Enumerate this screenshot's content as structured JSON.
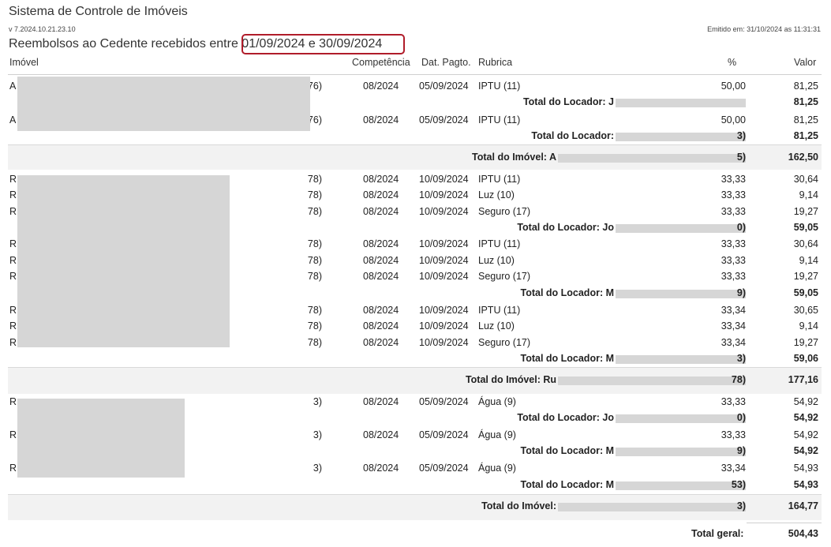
{
  "header": {
    "title": "Sistema de Controle de Imóveis",
    "version": "v 7.2024.10.21.23.10",
    "emitted": "Emitido em: 31/10/2024 as 11:31:31",
    "subtitle_prefix": "Reembolsos ao Cedente recebidos entre",
    "period": "01/09/2024 e 30/09/2024"
  },
  "columns": {
    "imovel": "Imóvel",
    "competencia": "Competência",
    "dat_pagto": "Dat. Pagto.",
    "rubrica": "Rubrica",
    "pct": "%",
    "valor": "Valor"
  },
  "rows": [
    {
      "kind": "item",
      "prefix": "A",
      "suffix": "76)",
      "comp": "08/2024",
      "date": "05/09/2024",
      "rub": "IPTU (11)",
      "pct": "50,00",
      "val": "81,25"
    },
    {
      "kind": "loc",
      "label": "Total do Locador: J",
      "val": "81,25"
    },
    {
      "kind": "item",
      "prefix": "A",
      "suffix": "76)",
      "comp": "08/2024",
      "date": "05/09/2024",
      "rub": "IPTU (11)",
      "pct": "50,00",
      "val": "81,25"
    },
    {
      "kind": "loc",
      "label": "Total do Locador:",
      "suffix": "3)",
      "val": "81,25"
    },
    {
      "kind": "imo",
      "label": "Total do Imóvel: A",
      "suffix": "5)",
      "val": "162,50"
    },
    {
      "kind": "item",
      "prefix": "R",
      "suffix": "78)",
      "comp": "08/2024",
      "date": "10/09/2024",
      "rub": "IPTU (11)",
      "pct": "33,33",
      "val": "30,64"
    },
    {
      "kind": "item",
      "prefix": "R",
      "suffix": "78)",
      "comp": "08/2024",
      "date": "10/09/2024",
      "rub": "Luz (10)",
      "pct": "33,33",
      "val": "9,14"
    },
    {
      "kind": "item",
      "prefix": "R",
      "suffix": "78)",
      "comp": "08/2024",
      "date": "10/09/2024",
      "rub": "Seguro (17)",
      "pct": "33,33",
      "val": "19,27"
    },
    {
      "kind": "loc",
      "label": "Total do Locador: Jo",
      "suffix": "0)",
      "val": "59,05"
    },
    {
      "kind": "item",
      "prefix": "R",
      "suffix": "78)",
      "comp": "08/2024",
      "date": "10/09/2024",
      "rub": "IPTU (11)",
      "pct": "33,33",
      "val": "30,64"
    },
    {
      "kind": "item",
      "prefix": "R",
      "suffix": "78)",
      "comp": "08/2024",
      "date": "10/09/2024",
      "rub": "Luz (10)",
      "pct": "33,33",
      "val": "9,14"
    },
    {
      "kind": "item",
      "prefix": "R",
      "suffix": "78)",
      "comp": "08/2024",
      "date": "10/09/2024",
      "rub": "Seguro (17)",
      "pct": "33,33",
      "val": "19,27"
    },
    {
      "kind": "loc",
      "label": "Total do Locador: M",
      "suffix": "9)",
      "val": "59,05"
    },
    {
      "kind": "item",
      "prefix": "R",
      "suffix": "78)",
      "comp": "08/2024",
      "date": "10/09/2024",
      "rub": "IPTU (11)",
      "pct": "33,34",
      "val": "30,65"
    },
    {
      "kind": "item",
      "prefix": "R",
      "suffix": "78)",
      "comp": "08/2024",
      "date": "10/09/2024",
      "rub": "Luz (10)",
      "pct": "33,34",
      "val": "9,14"
    },
    {
      "kind": "item",
      "prefix": "R",
      "suffix": "78)",
      "comp": "08/2024",
      "date": "10/09/2024",
      "rub": "Seguro (17)",
      "pct": "33,34",
      "val": "19,27"
    },
    {
      "kind": "loc",
      "label": "Total do Locador: M",
      "suffix": "3)",
      "val": "59,06"
    },
    {
      "kind": "imo",
      "label": "Total do Imóvel: Ru",
      "suffix": "78)",
      "val": "177,16"
    },
    {
      "kind": "item",
      "prefix": "R",
      "suffix": "3)",
      "comp": "08/2024",
      "date": "05/09/2024",
      "rub": "Água (9)",
      "pct": "33,33",
      "val": "54,92"
    },
    {
      "kind": "loc",
      "label": "Total do Locador: Jo",
      "suffix": "0)",
      "val": "54,92"
    },
    {
      "kind": "item",
      "prefix": "R",
      "suffix": "3)",
      "comp": "08/2024",
      "date": "05/09/2024",
      "rub": "Água (9)",
      "pct": "33,33",
      "val": "54,92"
    },
    {
      "kind": "loc",
      "label": "Total do Locador: M",
      "suffix": "9)",
      "val": "54,92"
    },
    {
      "kind": "item",
      "prefix": "R",
      "suffix": "3)",
      "comp": "08/2024",
      "date": "05/09/2024",
      "rub": "Água (9)",
      "pct": "33,34",
      "val": "54,93"
    },
    {
      "kind": "loc",
      "label": "Total do Locador: M",
      "suffix": "53)",
      "val": "54,93"
    },
    {
      "kind": "imo",
      "label": "Total do Imóvel:",
      "suffix": "3)",
      "val": "164,77"
    }
  ],
  "total_geral": {
    "label": "Total geral:",
    "val": "504,43"
  }
}
